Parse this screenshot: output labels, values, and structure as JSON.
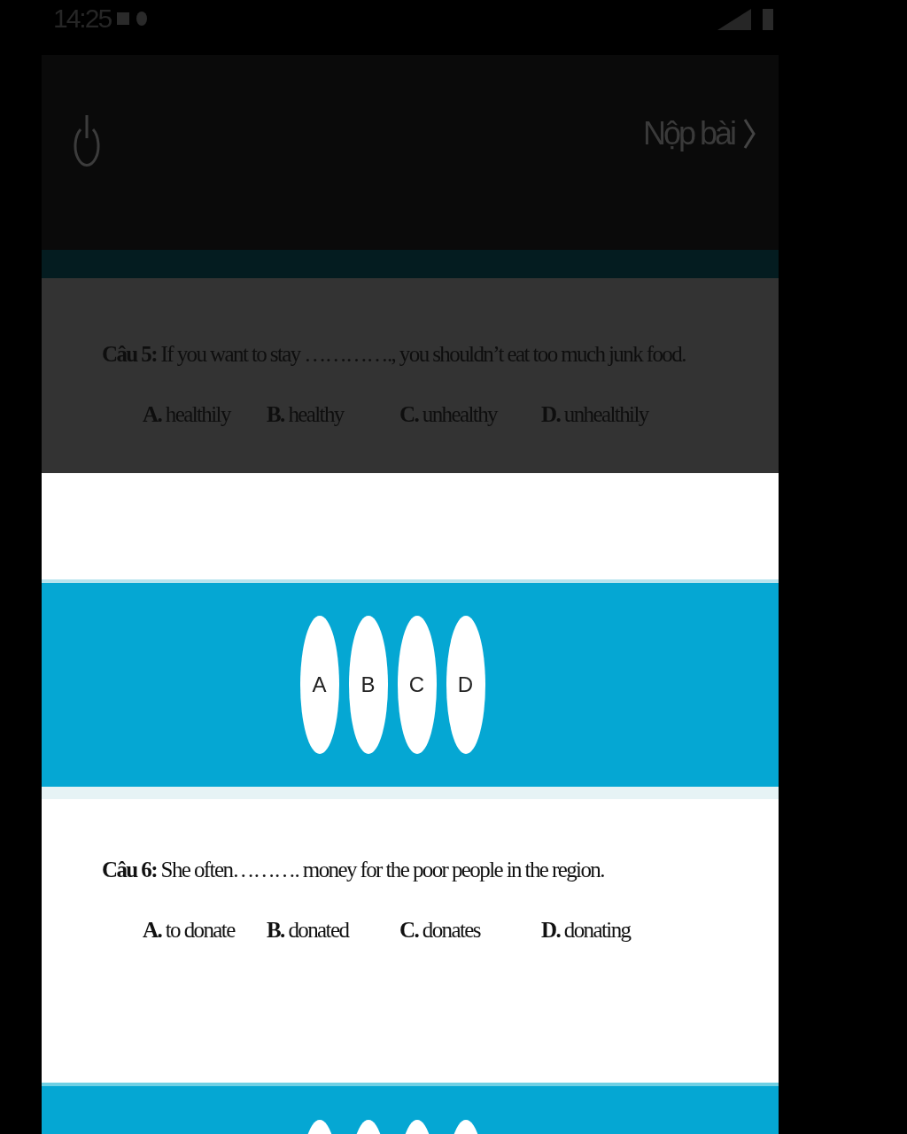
{
  "status_bar": {
    "time": "14:25"
  },
  "header": {
    "submit_label": "Nộp bài"
  },
  "questions": [
    {
      "dimmed": true,
      "text": "**Câu 5:** If you want to stay …………., you shouldn’t eat too much junk food.",
      "options": [
        "**A.** healthily",
        "**B.** healthy",
        "**C.** unhealthy",
        "**D.** unhealthily"
      ]
    },
    {
      "dimmed": false,
      "text": "**Câu 6:** She  often………. money for the poor people in the region.",
      "options": [
        "**A.** to donate",
        "**B.** donated",
        "**C.** donates",
        "**D.** donating"
      ]
    }
  ],
  "answer_bars": [
    {
      "choices": [
        {
          "letter": "A",
          "selected": false
        },
        {
          "letter": "B",
          "selected": false
        },
        {
          "letter": "C",
          "selected": false
        },
        {
          "letter": "D",
          "selected": false
        }
      ]
    },
    {
      "choices": [
        {
          "selected": false
        },
        {
          "selected": false
        },
        {
          "selected": false
        },
        {
          "selected": false
        }
      ]
    }
  ]
}
